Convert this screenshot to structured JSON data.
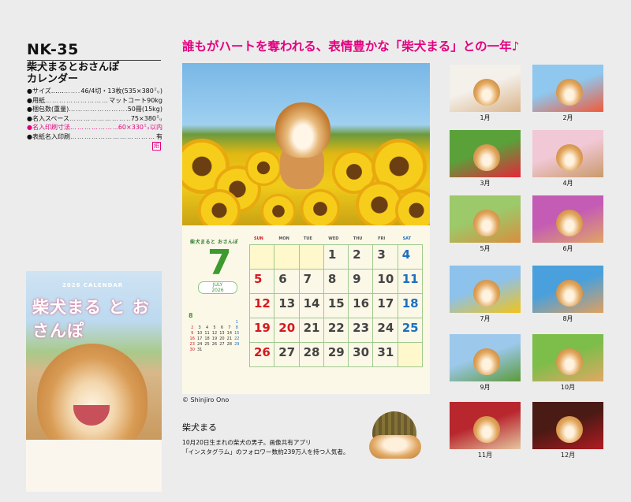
{
  "product": {
    "code": "NK-35",
    "name_line1": "柴犬まるとおさんぽ",
    "name_line2": "カレンダー"
  },
  "specs": [
    {
      "label": "●サイズ……",
      "value": "46/4切・13枚(535×380㍉)",
      "highlight": false
    },
    {
      "label": "●用紙",
      "value": "マットコート90kg",
      "highlight": false
    },
    {
      "label": "●梱包数(重量)",
      "value": "50冊(15kg)",
      "highlight": false
    },
    {
      "label": "●名入スペース",
      "value": "75×380㍉",
      "highlight": false
    },
    {
      "label": "●名入印刷寸法",
      "value": "60×330㍉以内",
      "highlight": true
    },
    {
      "label": "●表紙名入印刷",
      "value": "有",
      "highlight": false
    }
  ],
  "badge": "紙",
  "cover": {
    "year": "2026 CALENDAR",
    "title": "柴犬まる と おさんぽ"
  },
  "headline": "誰もがハートを奪われる、表情豊かな「柴犬まる」との一年♪",
  "calendar": {
    "brand": "柴犬まると おさんぽ",
    "month": "7",
    "bone_en": "JULY",
    "bone_year": "2026",
    "weekdays": [
      "SUN",
      "MON",
      "TUE",
      "WED",
      "THU",
      "FRI",
      "SAT"
    ],
    "days": [
      "",
      "",
      "",
      "1",
      "2",
      "3",
      "4",
      "5",
      "6",
      "7",
      "8",
      "9",
      "10",
      "11",
      "12",
      "13",
      "14",
      "15",
      "16",
      "17",
      "18",
      "19",
      "20",
      "21",
      "22",
      "23",
      "24",
      "25",
      "26",
      "27",
      "28",
      "29",
      "30",
      "31",
      ""
    ],
    "holidays": [
      "20"
    ],
    "mini_month": "8",
    "mini_days": [
      "",
      "",
      "",
      "",
      "",
      "",
      "1",
      "2",
      "3",
      "4",
      "5",
      "6",
      "7",
      "8",
      "9",
      "10",
      "11",
      "12",
      "13",
      "14",
      "15",
      "16",
      "17",
      "18",
      "19",
      "20",
      "21",
      "22",
      "23",
      "24",
      "25",
      "26",
      "27",
      "28",
      "29",
      "30",
      "31"
    ]
  },
  "copyright": "© Shinjiro Ono",
  "bio": {
    "name": "柴犬まる",
    "line1": "10月20日生まれの柴犬の男子。画像共有アプリ",
    "line2": "「インスタグラム」のフォロワー数約239万人を持つ人気者。"
  },
  "months": [
    {
      "label": "1月",
      "bg": [
        "#f4f0ea",
        "#d9b48a"
      ]
    },
    {
      "label": "2月",
      "bg": [
        "#8fc7ee",
        "#f25a3a"
      ]
    },
    {
      "label": "3月",
      "bg": [
        "#5aa13a",
        "#e6263a"
      ]
    },
    {
      "label": "4月",
      "bg": [
        "#f1c8d6",
        "#c99a6a"
      ]
    },
    {
      "label": "5月",
      "bg": [
        "#9cc96a",
        "#d98e3e"
      ]
    },
    {
      "label": "6月",
      "bg": [
        "#c45bb5",
        "#e0a564"
      ]
    },
    {
      "label": "7月",
      "bg": [
        "#8cc2ec",
        "#f2c31a"
      ]
    },
    {
      "label": "8月",
      "bg": [
        "#4aa0dc",
        "#e0a05e"
      ]
    },
    {
      "label": "9月",
      "bg": [
        "#9cc8ec",
        "#5c9a3a"
      ]
    },
    {
      "label": "10月",
      "bg": [
        "#7dbd4a",
        "#e1a864"
      ]
    },
    {
      "label": "11月",
      "bg": [
        "#b8262e",
        "#e5c6a0"
      ]
    },
    {
      "label": "12月",
      "bg": [
        "#4a1a14",
        "#b11b22"
      ]
    }
  ]
}
